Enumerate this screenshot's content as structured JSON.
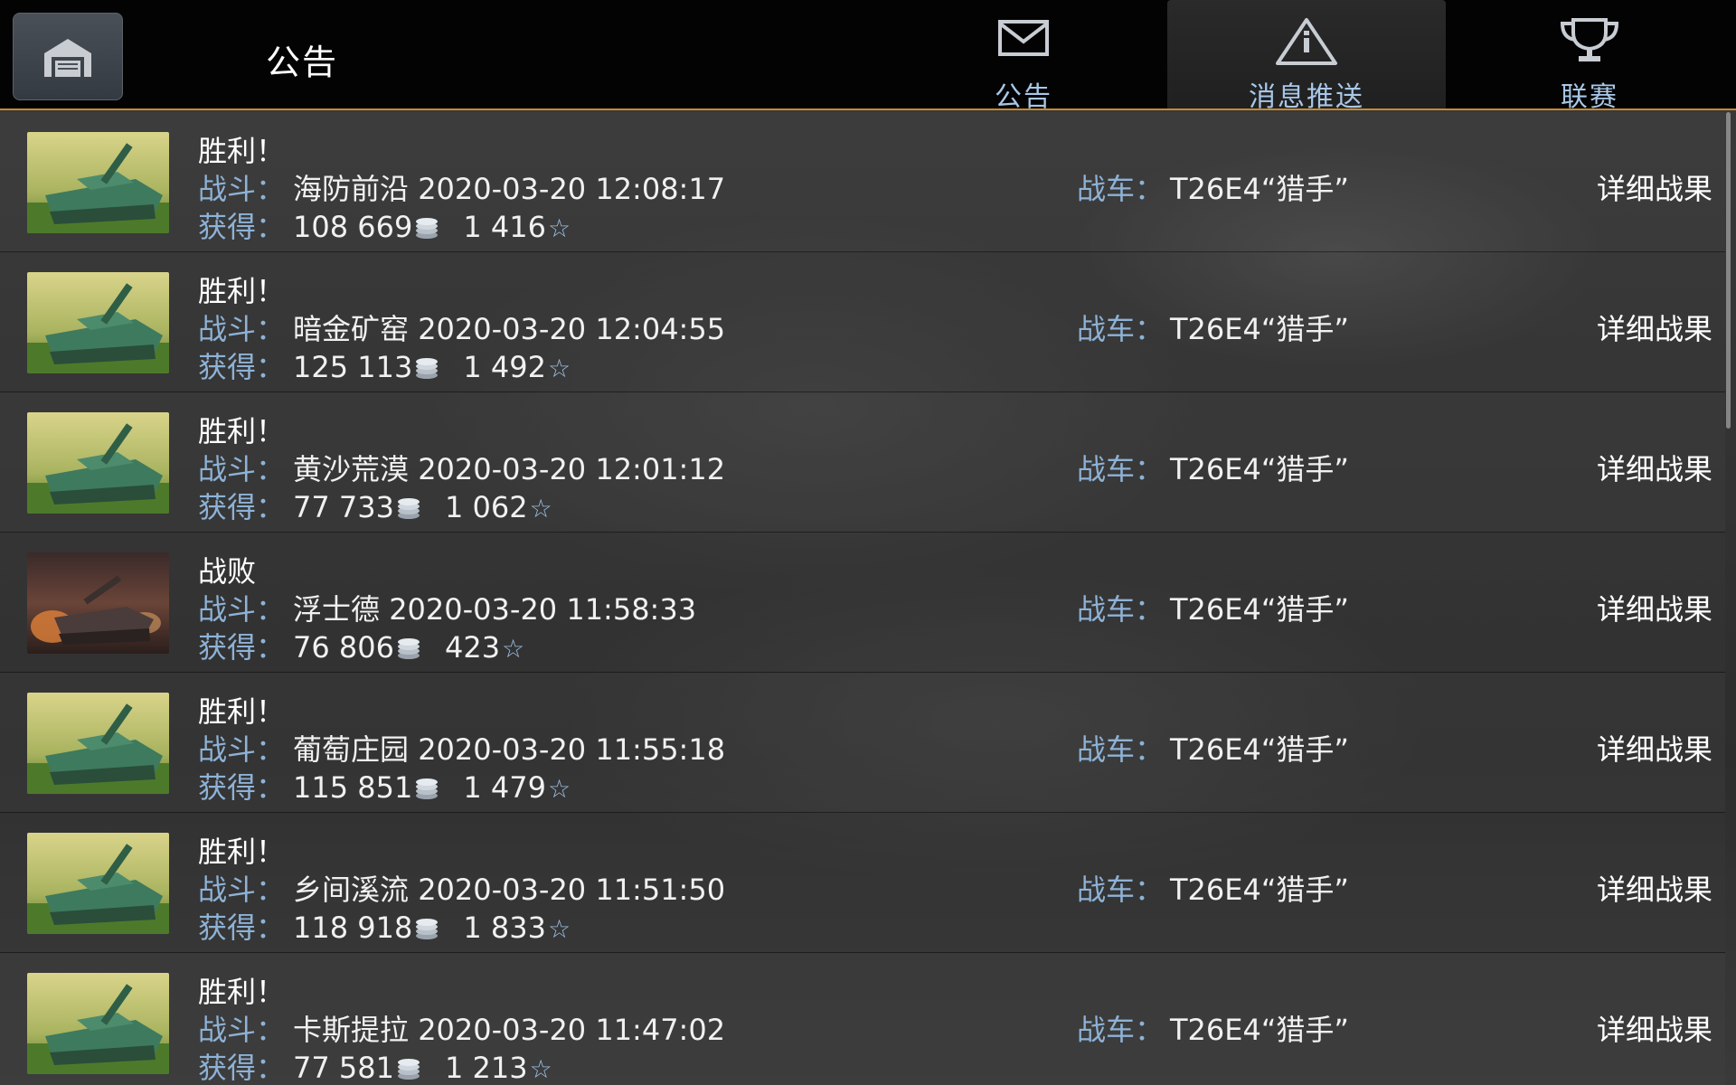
{
  "header": {
    "title": "公告",
    "tabs": [
      {
        "label": "公告",
        "icon": "envelope-icon",
        "active": false
      },
      {
        "label": "消息推送",
        "icon": "warning-triangle-icon",
        "active": true
      },
      {
        "label": "联赛",
        "icon": "trophy-icon",
        "active": false
      }
    ]
  },
  "labels": {
    "battle": "战斗：",
    "earned": "获得：",
    "tank": "战车：",
    "details": "详细战果"
  },
  "colors": {
    "accent_line": "#c98a2e",
    "label_blue": "#8eb2d6",
    "tab_label": "#a8c7e8"
  },
  "battles": [
    {
      "result": "胜利！",
      "map": "海防前沿",
      "datetime": "2020-03-20 12:08:17",
      "credits": "108 669",
      "xp": "1 416",
      "tank": "T26E4“猎手”",
      "thumb": "victory-tank"
    },
    {
      "result": "胜利！",
      "map": "暗金矿窑",
      "datetime": "2020-03-20 12:04:55",
      "credits": "125 113",
      "xp": "1 492",
      "tank": "T26E4“猎手”",
      "thumb": "victory-tank"
    },
    {
      "result": "胜利！",
      "map": "黄沙荒漠",
      "datetime": "2020-03-20 12:01:12",
      "credits": "77 733",
      "xp": "1 062",
      "tank": "T26E4“猎手”",
      "thumb": "victory-tank"
    },
    {
      "result": "战败",
      "map": "浮士德",
      "datetime": "2020-03-20 11:58:33",
      "credits": "76 806",
      "xp": "423",
      "tank": "T26E4“猎手”",
      "thumb": "defeat-tank"
    },
    {
      "result": "胜利！",
      "map": "葡萄庄园",
      "datetime": "2020-03-20 11:55:18",
      "credits": "115 851",
      "xp": "1 479",
      "tank": "T26E4“猎手”",
      "thumb": "victory-tank"
    },
    {
      "result": "胜利！",
      "map": "乡间溪流",
      "datetime": "2020-03-20 11:51:50",
      "credits": "118 918",
      "xp": "1 833",
      "tank": "T26E4“猎手”",
      "thumb": "victory-tank"
    },
    {
      "result": "胜利！",
      "map": "卡斯提拉",
      "datetime": "2020-03-20 11:47:02",
      "credits": "77 581",
      "xp": "1 213",
      "tank": "T26E4“猎手”",
      "thumb": "victory-tank"
    }
  ]
}
